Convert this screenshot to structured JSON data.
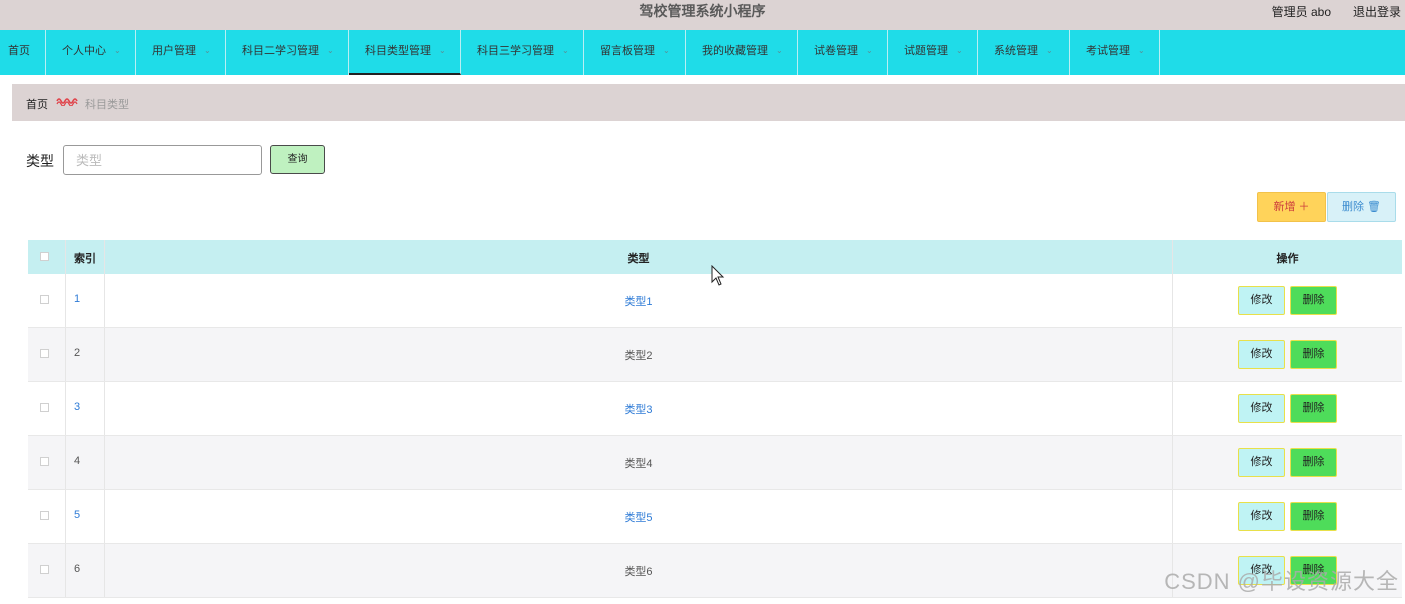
{
  "app": {
    "title": "驾校管理系统小程序",
    "user": "管理员 abo",
    "logout": "退出登录"
  },
  "nav": [
    {
      "label": "首页",
      "dropdown": false
    },
    {
      "label": "个人中心",
      "dropdown": true
    },
    {
      "label": "用户管理",
      "dropdown": true
    },
    {
      "label": "科目二学习管理",
      "dropdown": true
    },
    {
      "label": "科目类型管理",
      "dropdown": true,
      "active": true
    },
    {
      "label": "科目三学习管理",
      "dropdown": true
    },
    {
      "label": "留言板管理",
      "dropdown": true
    },
    {
      "label": "我的收藏管理",
      "dropdown": true
    },
    {
      "label": "试卷管理",
      "dropdown": true
    },
    {
      "label": "试题管理",
      "dropdown": true
    },
    {
      "label": "系统管理",
      "dropdown": true
    },
    {
      "label": "考试管理",
      "dropdown": true
    }
  ],
  "breadcrumb": {
    "home": "首页",
    "current": "科目类型"
  },
  "search": {
    "label": "类型",
    "placeholder": "类型",
    "value": "",
    "button": "查询"
  },
  "actions": {
    "add": "新增 ＋",
    "delete": "删除 🗑"
  },
  "table": {
    "headers": {
      "index": "索引",
      "type": "类型",
      "ops": "操作"
    },
    "rows": [
      {
        "index": "1",
        "type": "类型1",
        "link": true
      },
      {
        "index": "2",
        "type": "类型2",
        "link": false
      },
      {
        "index": "3",
        "type": "类型3",
        "link": true
      },
      {
        "index": "4",
        "type": "类型4",
        "link": false
      },
      {
        "index": "5",
        "type": "类型5",
        "link": true
      },
      {
        "index": "6",
        "type": "类型6",
        "link": false
      }
    ],
    "edit_label": "修改",
    "delete_label": "删除"
  },
  "watermark": "CSDN @毕设资源大全",
  "colors": {
    "nav_bg": "#1fdce8",
    "header_bg": "#dcd3d3",
    "table_header_bg": "#c5eff1",
    "link": "#2e7bd6",
    "delete_btn": "#4edc5a",
    "add_btn": "#ffd35a"
  }
}
